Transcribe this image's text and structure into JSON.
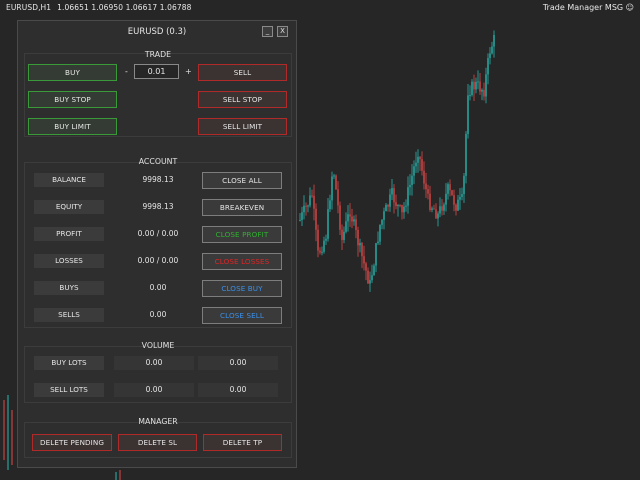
{
  "chart_header": {
    "symbol": "EURUSD,H1",
    "ohlc": "1.06651 1.06950 1.06617 1.06788",
    "ea_name": "Trade Manager MSG",
    "smiley": "☺"
  },
  "panel": {
    "title": "EURUSD (0.3)",
    "minimize": "_",
    "close": "X",
    "trade": {
      "title": "TRADE",
      "buy": "BUY",
      "sell": "SELL",
      "minus": "-",
      "plus": "+",
      "lot": "0.01",
      "buy_stop": "BUY STOP",
      "sell_stop": "SELL STOP",
      "buy_limit": "BUY LIMIT",
      "sell_limit": "SELL LIMIT"
    },
    "account": {
      "title": "ACCOUNT",
      "rows": [
        {
          "label": "BALANCE",
          "value": "9998.13",
          "button": "CLOSE ALL"
        },
        {
          "label": "EQUITY",
          "value": "9998.13",
          "button": "BREAKEVEN"
        },
        {
          "label": "PROFIT",
          "value": "0.00 / 0.00",
          "button": "CLOSE PROFIT"
        },
        {
          "label": "LOSSES",
          "value": "0.00 / 0.00",
          "button": "CLOSE LOSSES"
        },
        {
          "label": "BUYS",
          "value": "0.00",
          "button": "CLOSE BUY"
        },
        {
          "label": "SELLS",
          "value": "0.00",
          "button": "CLOSE SELL"
        }
      ]
    },
    "volume": {
      "title": "VOLUME",
      "rows": [
        {
          "label": "BUY LOTS",
          "v1": "0.00",
          "v2": "0.00"
        },
        {
          "label": "SELL LOTS",
          "v1": "0.00",
          "v2": "0.00"
        }
      ]
    },
    "manager": {
      "title": "MANAGER",
      "delete_pending": "DELETE PENDING",
      "delete_sl": "DELETE SL",
      "delete_tp": "DELETE TP"
    }
  },
  "colors": {
    "background": "#262626",
    "bull_candle": "#2ab5ae",
    "bear_candle": "#e04848",
    "close_profit_text": "#2fb02f",
    "close_losses_text": "#e02424",
    "close_buy_sell_text": "#3a8fe8"
  }
}
